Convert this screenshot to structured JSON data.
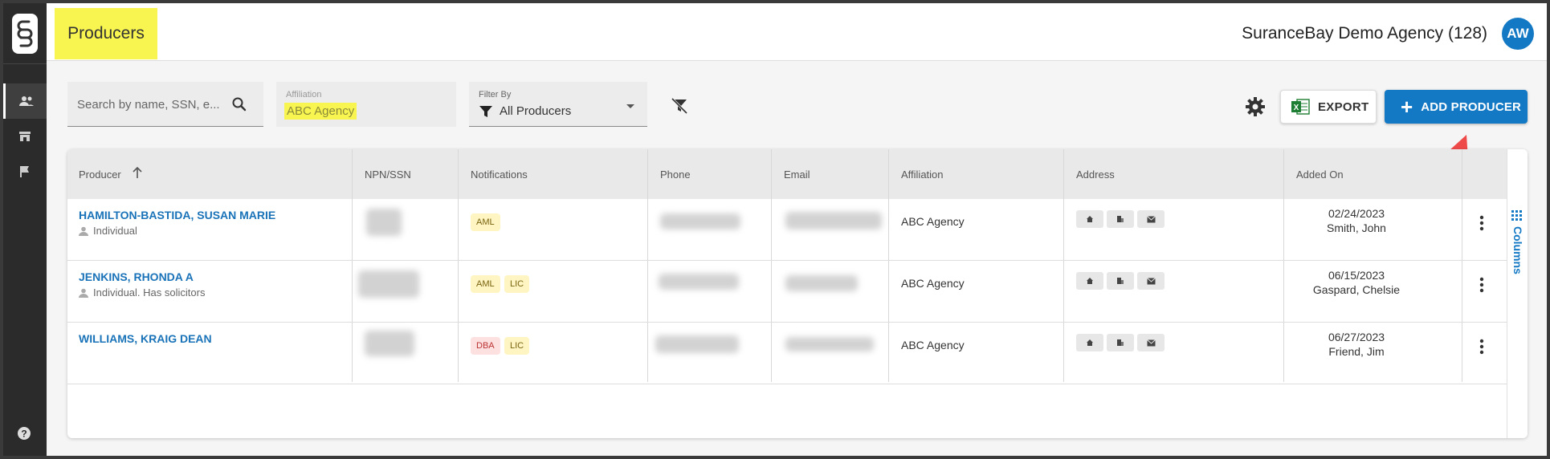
{
  "header": {
    "page_title": "Producers",
    "agency_name": "SuranceBay Demo Agency (128)",
    "avatar_initials": "AW"
  },
  "toolbar": {
    "search_placeholder": "Search by name, SSN, e...",
    "affiliation_label": "Affiliation",
    "affiliation_value": "ABC Agency",
    "filter_label": "Filter By",
    "filter_value": "All Producers",
    "export_label": "EXPORT",
    "add_label": "ADD PRODUCER"
  },
  "table": {
    "columns": [
      "Producer",
      "NPN/SSN",
      "Notifications",
      "Phone",
      "Email",
      "Affiliation",
      "Address",
      "Added On"
    ],
    "columns_toggle": "Columns",
    "rows": [
      {
        "name": "HAMILTON-BASTIDA, SUSAN MARIE",
        "type": "Individual",
        "badges": [
          "AML"
        ],
        "affiliation": "ABC Agency",
        "date": "02/24/2023",
        "added_by": "Smith, John"
      },
      {
        "name": "JENKINS, RHONDA A",
        "type": "Individual. Has solicitors",
        "badges": [
          "AML",
          "LIC"
        ],
        "affiliation": "ABC Agency",
        "date": "06/15/2023",
        "added_by": "Gaspard, Chelsie"
      },
      {
        "name": "WILLIAMS, KRAIG DEAN",
        "type": "",
        "badges": [
          "DBA",
          "LIC"
        ],
        "affiliation": "ABC Agency",
        "date": "06/27/2023",
        "added_by": "Friend, Jim"
      }
    ]
  },
  "colors": {
    "accent": "#1479c4",
    "highlight": "#f8f450",
    "sidebar": "#2b2b2b"
  },
  "icons": [
    "logo-icon",
    "people-icon",
    "store-icon",
    "flag-icon",
    "help-icon",
    "search-icon",
    "filter-icon",
    "clear-filter-icon",
    "gear-icon",
    "excel-icon",
    "plus-icon",
    "person-icon",
    "home-icon",
    "building-icon",
    "mail-icon",
    "kebab-icon",
    "grid-icon"
  ]
}
